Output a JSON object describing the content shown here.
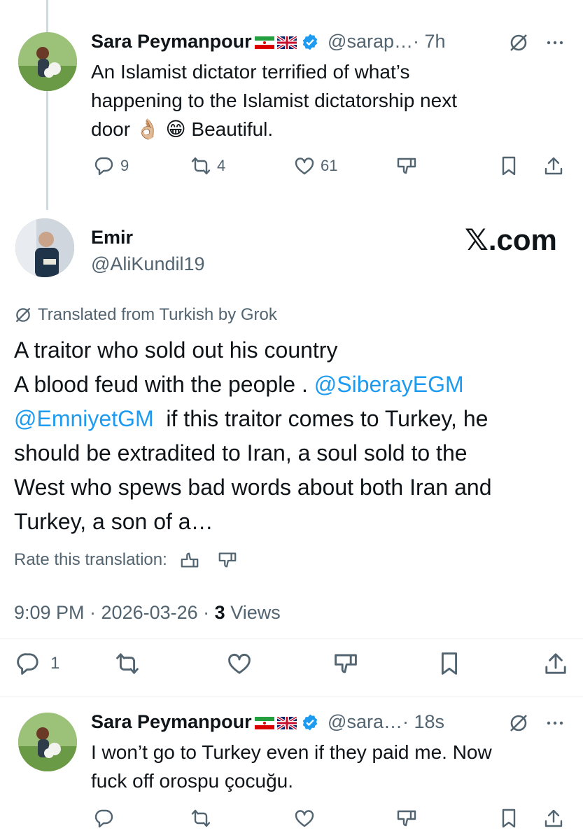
{
  "reply1": {
    "name": "Sara Peymanpour",
    "handle": "@sarap…",
    "time": "· 7h",
    "text_lines": [
      "An Islamist dictator terrified of what’s",
      "happening to the Islamist dictatorship next",
      "door 👌🏼 😁 Beautiful."
    ],
    "replies": "9",
    "reposts": "4",
    "likes": "61"
  },
  "main": {
    "name": "Emir",
    "handle": "@AliKundil19",
    "brand": "𝕏.com",
    "translated_label": "Translated from Turkish by Grok",
    "line1": "A traitor who sold out his country",
    "line2_text": "A blood feud with the people . ",
    "mention1": "@SiberayEGM",
    "mention2": "@EmniyetGM",
    "line3_text": "  if this traitor comes to Turkey, he",
    "line4": "should be extradited to Iran, a soul sold to the",
    "line5": "West who spews bad words about both Iran and",
    "line6": "Turkey, a son of a…",
    "rate_label": "Rate this translation:",
    "timestamp": "9:09 PM · 2026-03-26 · ",
    "views_count": "3",
    "views_label": " Views",
    "replies": "1"
  },
  "reply2": {
    "name": "Sara Peymanpour",
    "handle": "@sara…",
    "time": "· 18s",
    "text_lines": [
      "I won’t go to Turkey even if they paid me. Now",
      "fuck off orospu çocuğu."
    ]
  },
  "colors": {
    "accent": "#1d9bf0",
    "muted": "#536471",
    "text": "#0f1419"
  }
}
